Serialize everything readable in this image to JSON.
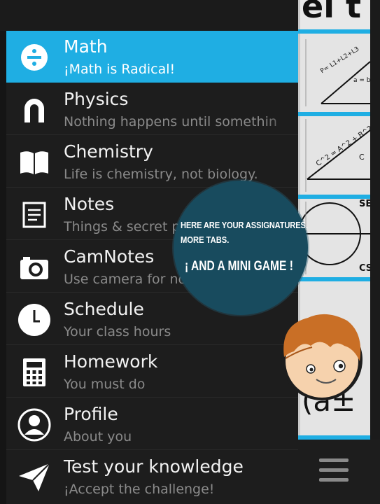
{
  "menu": {
    "items": [
      {
        "title": "Math",
        "subtitle": "¡Math is Radical!",
        "icon": "divide-icon",
        "active": true
      },
      {
        "title": "Physics",
        "subtitle": "Nothing happens until somethin",
        "icon": "magnet-icon"
      },
      {
        "title": "Chemistry",
        "subtitle": "Life is chemistry, not biology.",
        "icon": "book-icon"
      },
      {
        "title": "Notes",
        "subtitle": "Things & secret plans",
        "icon": "notepad-icon"
      },
      {
        "title": "CamNotes",
        "subtitle": "Use camera for notes",
        "icon": "camera-icon"
      },
      {
        "title": "Schedule",
        "subtitle": "Your class hours",
        "icon": "clock-icon"
      },
      {
        "title": "Homework",
        "subtitle": "You must do",
        "icon": "calculator-icon"
      },
      {
        "title": "Profile",
        "subtitle": "About you",
        "icon": "profile-icon"
      },
      {
        "title": "Test your knowledge",
        "subtitle": "¡Accept the challenge!",
        "icon": "paper-plane-icon"
      }
    ]
  },
  "background": {
    "header_text": "el t",
    "formula_1": "P= L1+L2+L3",
    "formula_1b": "a = b",
    "formula_2": "C^2 = A^2 + B^2",
    "formula_2b": "C",
    "formula_3a": "SE",
    "formula_3b": "CS",
    "formula_4": "(a±",
    "menu_icon": "hamburger-menu-icon"
  },
  "tooltip": {
    "line1": "HERE ARE YOUR ASSIGNATURES,",
    "line2": "MORE TABS.",
    "line3": "¡ AND A MINI GAME !"
  },
  "colors": {
    "accent": "#1faee3",
    "bubble": "#184b5e",
    "drawer": "#1d1d1d"
  }
}
